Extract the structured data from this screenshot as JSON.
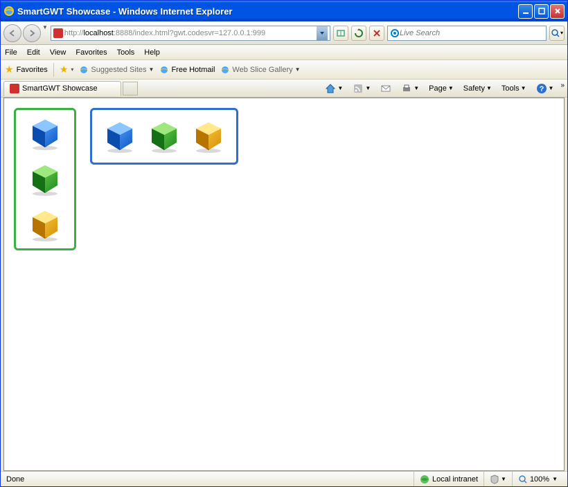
{
  "window": {
    "title": "SmartGWT Showcase - Windows Internet Explorer"
  },
  "nav": {
    "url_prefix": "http://",
    "url_host": "localhost",
    "url_suffix": ":8888/index.html?gwt.codesvr=127.0.0.1:999",
    "search_placeholder": "Live Search"
  },
  "menu": {
    "items": [
      "File",
      "Edit",
      "View",
      "Favorites",
      "Tools",
      "Help"
    ]
  },
  "bookmarks": {
    "favorites_label": "Favorites",
    "items": [
      {
        "label": "Suggested Sites"
      },
      {
        "label": "Free Hotmail"
      },
      {
        "label": "Web Slice Gallery"
      }
    ]
  },
  "tab": {
    "label": "SmartGWT Showcase"
  },
  "toolbar": {
    "page": "Page",
    "safety": "Safety",
    "tools": "Tools"
  },
  "content": {
    "vertical_panel": {
      "border_color": "#3cb043",
      "cubes": [
        "blue",
        "green",
        "yellow"
      ]
    },
    "horizontal_panel": {
      "border_color": "#2d6fcf",
      "cubes": [
        "blue",
        "green",
        "yellow"
      ]
    }
  },
  "status": {
    "left": "Done",
    "zone": "Local intranet",
    "zoom": "100%"
  }
}
